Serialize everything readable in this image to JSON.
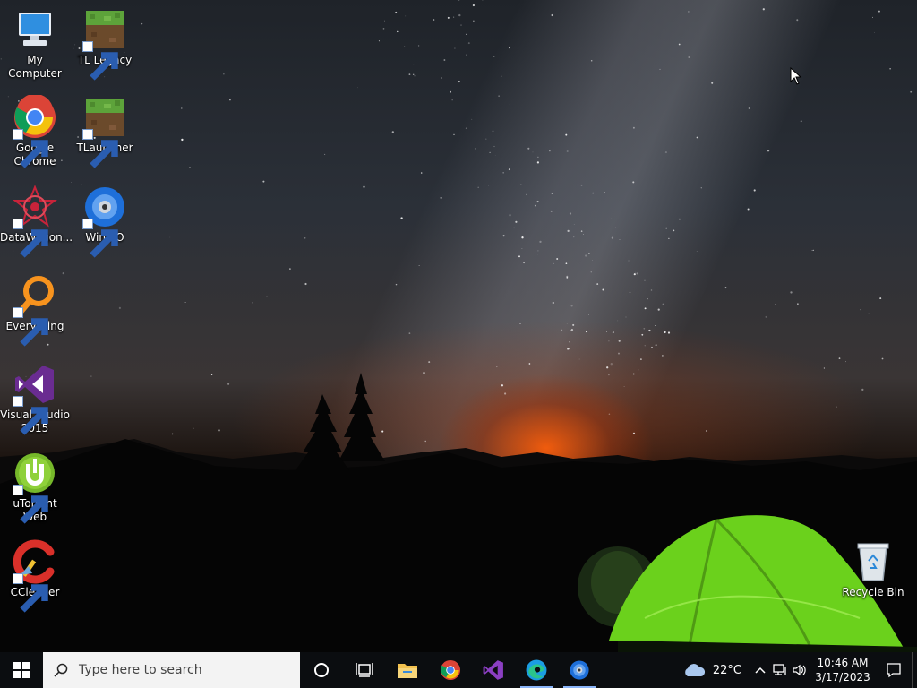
{
  "desktop": {
    "icons": [
      {
        "label": "My Computer",
        "icon": "monitor-icon"
      },
      {
        "label": "TL Legacy",
        "icon": "grass-block-icon"
      },
      {
        "label": "Google Chrome",
        "icon": "chrome-icon"
      },
      {
        "label": "TLauncher",
        "icon": "grass-block-icon"
      },
      {
        "label": "DataWagon...",
        "icon": "datawagon-icon"
      },
      {
        "label": "WinISO",
        "icon": "disc-icon"
      },
      {
        "label": "Everything",
        "icon": "magnifier-icon"
      },
      {
        "label": "Visual Studio 2015",
        "icon": "visual-studio-icon"
      },
      {
        "label": "uTorrent Web",
        "icon": "utorrent-icon"
      },
      {
        "label": "CCleaner",
        "icon": "ccleaner-icon"
      },
      {
        "label": "Recycle Bin",
        "icon": "recycle-bin-icon"
      }
    ]
  },
  "taskbar": {
    "search_placeholder": "Type here to search",
    "pinned": [
      {
        "name": "File Explorer",
        "icon": "folder-icon"
      },
      {
        "name": "Google Chrome",
        "icon": "chrome-icon"
      },
      {
        "name": "Visual Studio",
        "icon": "visual-studio-icon"
      },
      {
        "name": "Microsoft Edge",
        "icon": "edge-icon"
      },
      {
        "name": "WinISO",
        "icon": "disc-icon"
      }
    ],
    "weather": {
      "temp": "22°C",
      "icon": "cloud-icon"
    },
    "clock": {
      "time": "10:46 AM",
      "date": "3/17/2023"
    }
  },
  "colors": {
    "taskbar_bg": "#0b0d10",
    "search_bg": "#f3f3f3",
    "active_indicator": "#8ab4f8",
    "tent_green": "#7be026"
  }
}
